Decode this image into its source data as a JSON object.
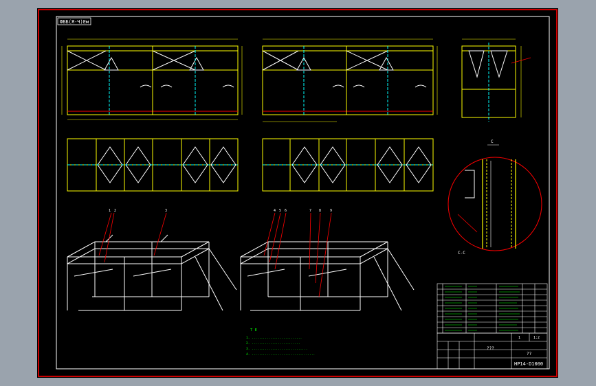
{
  "title_tag": "ФББ(Я-Ч)Ем",
  "drawing_number": "HP14-D1000",
  "title_block": {
    "label_title": "???",
    "label_sub": "??",
    "label_scale": "1:2",
    "label_sheet": "1"
  },
  "detail_label": "C-C",
  "detail_ref": "C",
  "notes": [
    "1. ...........................",
    "2. ..........................",
    "3. ..............................",
    "4. .................................."
  ],
  "notes_heading": "Т Е",
  "balloons_left": [
    "1",
    "2",
    "3"
  ],
  "balloons_right": [
    "4",
    "5",
    "6",
    "7",
    "8",
    "9"
  ],
  "colors": {
    "frame": "#ffffff",
    "yellow": "#ffff00",
    "red": "#ff0000",
    "green": "#00ff00",
    "cyan": "#00ffff",
    "sheet_border": "#cc0000",
    "background": "#9aa3ad"
  }
}
